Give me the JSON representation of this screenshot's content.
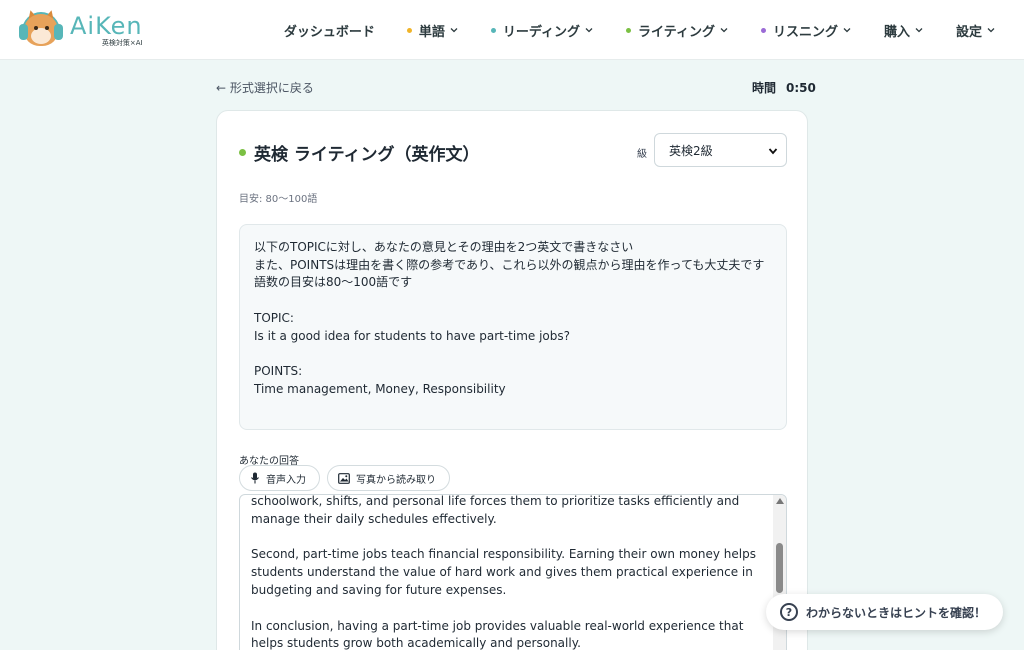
{
  "header": {
    "logo_text": "AiKen",
    "logo_sub": "英検対策×AI",
    "nav": [
      {
        "label": "ダッシュボード",
        "dot": null,
        "chevron": false
      },
      {
        "label": "単語",
        "dot": "#f0b429",
        "chevron": true
      },
      {
        "label": "リーディング",
        "dot": "#57b6b8",
        "chevron": true
      },
      {
        "label": "ライティング",
        "dot": "#7bc043",
        "chevron": true
      },
      {
        "label": "リスニング",
        "dot": "#9b6bd6",
        "chevron": true
      },
      {
        "label": "購入",
        "dot": null,
        "chevron": true
      },
      {
        "label": "設定",
        "dot": null,
        "chevron": true
      }
    ]
  },
  "topbar": {
    "back_label": "← 形式選択に戻る",
    "timer_label": "時間",
    "timer_value": "0:50"
  },
  "card": {
    "title": "英検 ライティング（英作文）",
    "title_dot_color": "#7bc043",
    "grade_label": "級",
    "grade_selected": "英検2級",
    "meta": "目安: 80〜100語",
    "prompt": {
      "line1": "以下のTOPICに対し、あなたの意見とその理由を2つ英文で書きなさい",
      "line2": "また、POINTSは理由を書く際の参考であり、これら以外の観点から理由を作っても大丈夫です",
      "line3": "語数の目安は80〜100語です",
      "topic_label": "TOPIC:",
      "topic": "Is it a good idea for students to have part-time jobs?",
      "points_label": "POINTS:",
      "points": "Time management, Money, Responsibility"
    },
    "answer_label": "あなたの回答",
    "voice_button": "音声入力",
    "photo_button": "写真から読み取り",
    "answer": {
      "para1": "schoolwork, shifts, and personal life forces them to prioritize tasks efficiently and manage their daily schedules effectively.",
      "para2": "Second, part-time jobs teach financial responsibility. Earning their own money helps students understand the value of hard work and gives them practical experience in budgeting and saving for future expenses.",
      "para3": "In conclusion, having a part-time job provides valuable real-world experience that helps students grow both academically and personally."
    }
  },
  "hint": {
    "label": "わからないときはヒントを確認！"
  }
}
